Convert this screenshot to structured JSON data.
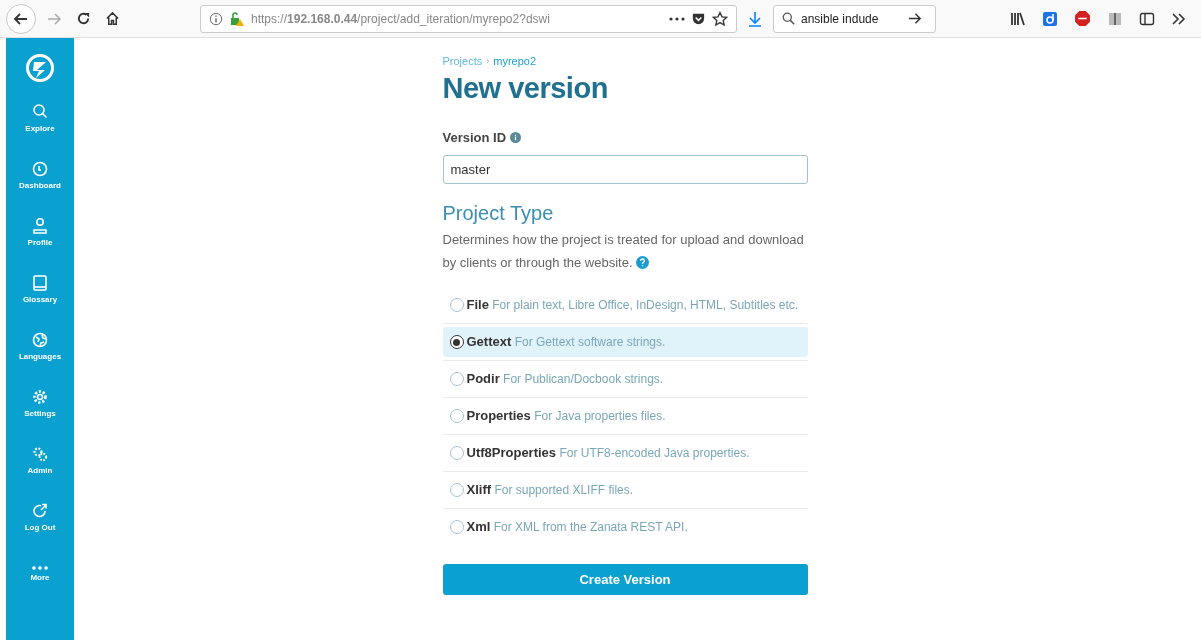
{
  "browser": {
    "url": "https://**192.168.0.44**/project/add_iteration/myrepo2?dswi",
    "search_value": "ansible indude"
  },
  "sidebar": {
    "items": [
      {
        "label": "Explore"
      },
      {
        "label": "Dashboard"
      },
      {
        "label": "Profile"
      },
      {
        "label": "Glossary"
      },
      {
        "label": "Languages"
      },
      {
        "label": "Settings"
      },
      {
        "label": "Admin"
      },
      {
        "label": "Log Out"
      },
      {
        "label": "More"
      }
    ]
  },
  "breadcrumb": [
    "Projects",
    "›",
    "myrepo2"
  ],
  "title": "New version",
  "version_id": {
    "label": "Version ID",
    "value": "master"
  },
  "project_type": {
    "heading": "Project Type",
    "description": "Determines how the project is treated for upload and download by clients or through the website.",
    "options": [
      {
        "name": "File",
        "description": "For plain text, Libre Office, InDesign, HTML, Subtitles etc.",
        "selected": false
      },
      {
        "name": "Gettext",
        "description": "For Gettext software strings.",
        "selected": true
      },
      {
        "name": "Podir",
        "description": "For Publican/Docbook strings.",
        "selected": false
      },
      {
        "name": "Properties",
        "description": "For Java properties files.",
        "selected": false
      },
      {
        "name": "Utf8Properties",
        "description": "For UTF8-encoded Java properties.",
        "selected": false
      },
      {
        "name": "Xliff",
        "description": "For supported XLIFF files.",
        "selected": false
      },
      {
        "name": "Xml",
        "description": "For XML from the Zanata REST API.",
        "selected": false
      }
    ]
  },
  "submit": "Create Version"
}
